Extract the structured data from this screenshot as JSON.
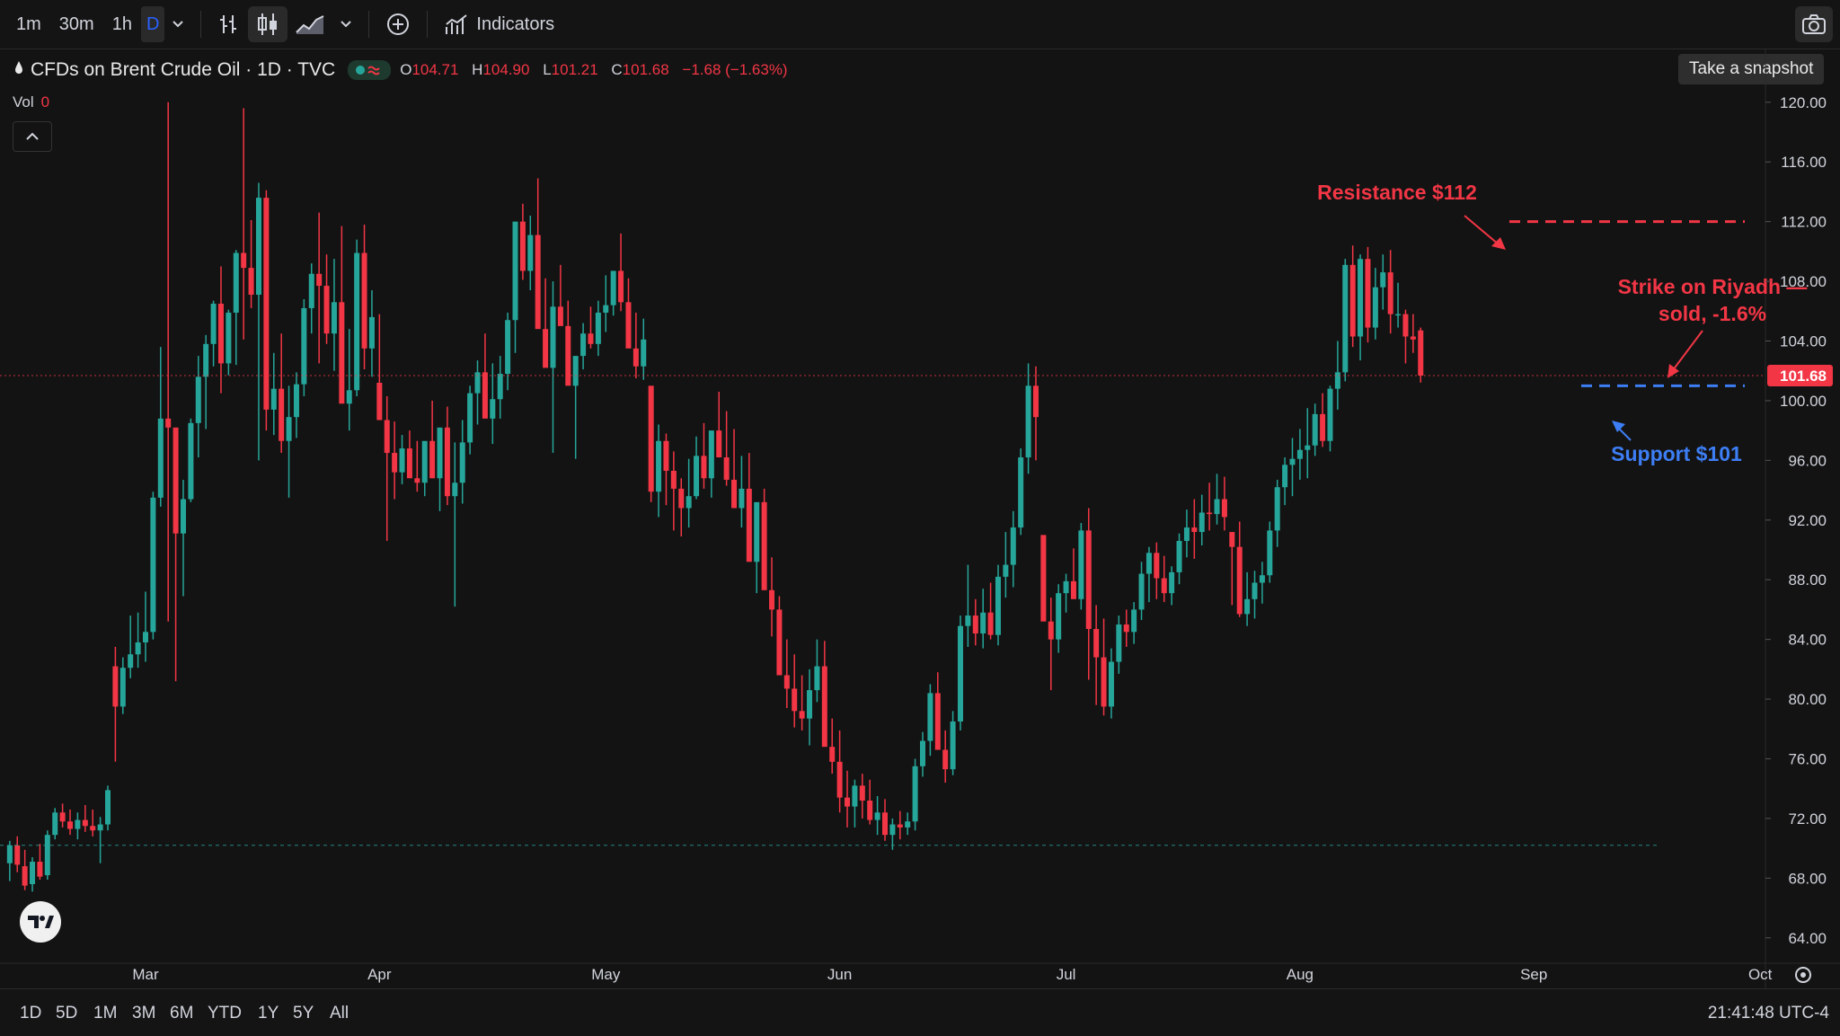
{
  "toolbar": {
    "timeframes": [
      "1m",
      "30m",
      "1h",
      "D"
    ],
    "indicators_label": "Indicators",
    "snapshot_tooltip": "Take a snapshot"
  },
  "legend": {
    "symbol": "CFDs on Brent Crude Oil · 1D · TVC",
    "o_label": "O",
    "o_value": "104.71",
    "h_label": "H",
    "h_value": "104.90",
    "l_label": "L",
    "l_value": "101.21",
    "c_label": "C",
    "c_value": "101.68",
    "change": "−1.68 (−1.63%)",
    "vol_label": "Vol",
    "vol_value": "0"
  },
  "colors": {
    "up": "#26a69a",
    "down": "#f23645",
    "support": "#3d7ef5",
    "background": "#131313"
  },
  "chart_data": {
    "type": "candlestick",
    "y_ticks": [
      "120.00",
      "116.00",
      "112.00",
      "108.00",
      "104.00",
      "100.00",
      "96.00",
      "92.00",
      "88.00",
      "84.00",
      "80.00",
      "76.00",
      "72.00",
      "68.00",
      "64.00"
    ],
    "ylim": [
      62.3,
      123.6
    ],
    "x_labels": [
      "Mar",
      "Apr",
      "May",
      "Jun",
      "Jul",
      "Aug",
      "Sep",
      "Oct"
    ],
    "x_label_days": [
      0,
      31,
      61,
      92,
      122,
      153,
      184,
      214
    ],
    "last_price": "101.68",
    "last_price_value": 101.68,
    "ohlc_days": [
      -18,
      -17,
      -16,
      -15,
      -14,
      -13,
      -12,
      -11,
      -10,
      -9,
      -8,
      -7,
      -6,
      -5,
      -4,
      -3,
      -2,
      -1,
      0,
      1,
      2,
      3,
      4,
      5,
      6,
      7,
      8,
      9,
      10,
      11,
      12,
      13,
      14,
      15,
      16,
      17,
      18,
      19,
      20,
      21,
      22,
      23,
      24,
      25,
      26,
      27,
      28,
      29,
      30,
      31,
      32,
      33,
      34,
      35,
      36,
      37,
      38,
      39,
      40,
      41,
      42,
      43,
      44,
      45,
      46,
      47,
      48,
      49,
      50,
      51,
      52,
      53,
      54,
      55,
      56,
      57,
      58,
      59,
      60,
      61,
      62,
      63,
      64,
      65,
      66,
      67,
      68,
      69,
      70,
      71,
      72,
      73,
      74,
      75,
      76,
      77,
      78,
      79,
      80,
      81,
      82,
      83,
      84,
      85,
      86,
      87,
      88,
      89,
      90,
      91,
      92,
      93,
      94,
      95,
      96,
      97,
      98,
      99,
      100,
      101,
      102,
      103,
      104,
      105,
      106,
      107,
      108,
      109,
      110,
      111,
      112,
      113,
      114,
      115,
      116,
      117,
      118,
      119,
      120,
      121,
      122,
      123,
      124,
      125,
      126,
      127,
      128,
      129,
      130,
      131,
      132,
      133,
      134,
      135,
      136,
      137,
      138,
      139,
      140,
      141,
      142,
      143,
      144,
      145,
      146,
      147,
      148,
      149,
      150,
      151,
      152,
      153,
      154,
      155,
      156,
      157,
      158,
      159,
      160,
      161,
      162,
      163,
      164,
      165,
      166,
      167,
      168,
      169,
      170,
      171,
      172,
      173,
      174,
      175,
      176,
      177,
      178,
      179,
      180,
      181,
      182,
      183,
      184,
      185,
      186,
      187,
      188,
      189,
      190,
      191,
      192,
      193,
      194,
      195,
      196,
      197,
      198,
      199,
      200
    ],
    "ohlc": [
      [
        69.0,
        70.5,
        67.8,
        70.2
      ],
      [
        70.2,
        70.8,
        68.4,
        68.9
      ],
      [
        68.8,
        69.9,
        67.2,
        67.5
      ],
      [
        67.6,
        69.4,
        67.1,
        69.1
      ],
      [
        69.1,
        70.3,
        67.9,
        68.1
      ],
      [
        68.2,
        71.2,
        67.9,
        70.9
      ],
      [
        70.9,
        72.7,
        70.6,
        72.4
      ],
      [
        72.4,
        73.0,
        71.4,
        71.8
      ],
      [
        71.8,
        72.6,
        70.9,
        71.3
      ],
      [
        71.3,
        72.4,
        70.6,
        71.9
      ],
      [
        71.9,
        72.9,
        71.1,
        71.5
      ],
      [
        71.5,
        72.6,
        70.8,
        71.2
      ],
      [
        71.2,
        72.1,
        69.0,
        71.6
      ],
      [
        71.6,
        74.2,
        71.2,
        73.9
      ],
      [
        82.2,
        83.5,
        75.8,
        79.5
      ],
      [
        79.5,
        82.8,
        79.0,
        82.1
      ],
      [
        82.1,
        85.6,
        81.4,
        83.0
      ],
      [
        83.0,
        85.8,
        82.1,
        83.8
      ],
      [
        83.8,
        87.2,
        82.5,
        84.5
      ],
      [
        84.5,
        93.9,
        84.0,
        93.5
      ],
      [
        93.5,
        103.6,
        92.9,
        98.8
      ],
      [
        98.8,
        120.0,
        85.2,
        98.2
      ],
      [
        98.2,
        97.5,
        81.2,
        91.1
      ],
      [
        91.1,
        94.7,
        86.9,
        93.4
      ],
      [
        93.4,
        98.8,
        93.2,
        98.5
      ],
      [
        98.5,
        103.0,
        96.2,
        101.6
      ],
      [
        101.6,
        104.4,
        98.1,
        103.8
      ],
      [
        103.8,
        106.7,
        102.3,
        106.5
      ],
      [
        106.5,
        109.0,
        100.5,
        102.5
      ],
      [
        102.5,
        106.1,
        101.7,
        105.9
      ],
      [
        105.9,
        110.1,
        102.4,
        109.9
      ],
      [
        109.9,
        119.6,
        104.1,
        108.9
      ],
      [
        108.9,
        112.1,
        106.2,
        107.1
      ],
      [
        107.1,
        114.6,
        96.0,
        113.6
      ],
      [
        113.6,
        114.1,
        98.0,
        99.4
      ],
      [
        99.4,
        103.2,
        97.7,
        100.8
      ],
      [
        100.8,
        104.5,
        96.5,
        97.3
      ],
      [
        97.3,
        101.0,
        93.5,
        98.9
      ],
      [
        98.9,
        101.9,
        97.5,
        101.1
      ],
      [
        101.1,
        106.8,
        100.3,
        106.2
      ],
      [
        106.2,
        109.2,
        104.5,
        108.5
      ],
      [
        108.5,
        112.6,
        102.5,
        107.7
      ],
      [
        107.7,
        109.8,
        103.8,
        104.5
      ],
      [
        104.5,
        109.5,
        102.0,
        106.6
      ],
      [
        106.6,
        111.7,
        102.5,
        99.8
      ],
      [
        99.8,
        104.8,
        98.0,
        100.7
      ],
      [
        100.7,
        110.8,
        100.3,
        109.9
      ],
      [
        109.9,
        111.8,
        102.1,
        103.5
      ],
      [
        103.5,
        107.4,
        101.6,
        105.6
      ],
      [
        101.2,
        105.8,
        99.4,
        98.7
      ],
      [
        98.7,
        100.3,
        90.6,
        96.5
      ],
      [
        96.5,
        98.6,
        93.4,
        95.2
      ],
      [
        95.2,
        97.7,
        94.4,
        96.8
      ],
      [
        96.8,
        98.0,
        95.0,
        94.8
      ],
      [
        94.8,
        97.3,
        93.9,
        94.5
      ],
      [
        94.5,
        97.2,
        93.6,
        97.3
      ],
      [
        97.3,
        100.0,
        95.1,
        94.8
      ],
      [
        94.8,
        97.6,
        92.6,
        98.2
      ],
      [
        98.2,
        99.6,
        93.0,
        93.6
      ],
      [
        93.6,
        97.2,
        86.2,
        94.5
      ],
      [
        94.5,
        98.7,
        93.1,
        97.2
      ],
      [
        97.2,
        101.0,
        96.4,
        100.5
      ],
      [
        100.5,
        102.7,
        98.4,
        101.9
      ],
      [
        101.9,
        104.5,
        99.4,
        98.8
      ],
      [
        98.8,
        102.5,
        97.1,
        100.1
      ],
      [
        100.1,
        103.0,
        98.8,
        101.8
      ],
      [
        101.8,
        105.9,
        100.7,
        105.4
      ],
      [
        105.4,
        110.1,
        103.2,
        112.0
      ],
      [
        112.0,
        113.2,
        108.1,
        108.7
      ],
      [
        108.7,
        112.4,
        107.4,
        111.1
      ],
      [
        111.1,
        114.9,
        108.3,
        104.8
      ],
      [
        104.8,
        108.2,
        104.0,
        102.2
      ],
      [
        102.2,
        108.0,
        96.5,
        106.3
      ],
      [
        106.3,
        109.1,
        105.4,
        105.0
      ],
      [
        105.0,
        106.7,
        103.9,
        101.0
      ],
      [
        101.0,
        102.9,
        96.1,
        103.0
      ],
      [
        103.0,
        105.2,
        102.1,
        104.5
      ],
      [
        104.5,
        106.3,
        103.5,
        103.8
      ],
      [
        103.8,
        106.7,
        103.0,
        105.9
      ],
      [
        105.9,
        108.4,
        104.6,
        106.4
      ],
      [
        106.4,
        107.8,
        105.7,
        108.7
      ],
      [
        108.7,
        111.2,
        106.0,
        106.6
      ],
      [
        106.6,
        108.2,
        104.5,
        103.5
      ],
      [
        103.5,
        105.9,
        101.5,
        102.3
      ],
      [
        102.3,
        105.5,
        101.4,
        104.1
      ],
      [
        101.0,
        98.8,
        93.2,
        93.9
      ],
      [
        93.9,
        98.4,
        92.2,
        97.3
      ],
      [
        97.3,
        97.8,
        93.0,
        95.3
      ],
      [
        95.3,
        96.6,
        91.3,
        94.1
      ],
      [
        94.1,
        94.8,
        90.9,
        92.8
      ],
      [
        92.8,
        96.1,
        91.5,
        93.6
      ],
      [
        93.6,
        97.6,
        93.4,
        96.3
      ],
      [
        96.3,
        98.5,
        94.1,
        94.8
      ],
      [
        94.8,
        97.9,
        93.5,
        98.0
      ],
      [
        98.0,
        100.6,
        96.2,
        96.2
      ],
      [
        96.2,
        99.3,
        94.3,
        94.7
      ],
      [
        94.7,
        98.1,
        93.7,
        92.8
      ],
      [
        92.8,
        96.3,
        91.5,
        94.1
      ],
      [
        94.1,
        96.5,
        92.2,
        89.2
      ],
      [
        89.2,
        92.6,
        87.1,
        93.2
      ],
      [
        93.2,
        94.1,
        89.9,
        87.3
      ],
      [
        87.3,
        89.5,
        84.2,
        86.0
      ],
      [
        86.0,
        86.9,
        82.4,
        81.6
      ],
      [
        81.6,
        84.0,
        79.4,
        80.7
      ],
      [
        80.7,
        83.0,
        78.1,
        79.2
      ],
      [
        79.2,
        81.6,
        77.9,
        78.7
      ],
      [
        78.7,
        82.0,
        76.9,
        80.6
      ],
      [
        80.6,
        84.0,
        79.8,
        82.2
      ],
      [
        82.2,
        83.9,
        80.4,
        76.8
      ],
      [
        76.8,
        78.7,
        75.0,
        75.8
      ],
      [
        75.8,
        77.9,
        72.4,
        73.4
      ],
      [
        73.4,
        75.2,
        71.4,
        72.8
      ],
      [
        72.8,
        74.6,
        71.4,
        74.2
      ],
      [
        74.2,
        75.0,
        72.0,
        73.2
      ],
      [
        73.2,
        74.6,
        71.6,
        71.9
      ],
      [
        71.9,
        73.5,
        70.9,
        72.4
      ],
      [
        72.4,
        73.3,
        70.5,
        70.9
      ],
      [
        70.9,
        72.0,
        69.9,
        71.6
      ],
      [
        71.6,
        72.5,
        70.6,
        71.4
      ],
      [
        71.4,
        72.4,
        70.9,
        71.8
      ],
      [
        71.8,
        76.0,
        71.2,
        75.5
      ],
      [
        75.5,
        77.8,
        74.8,
        77.2
      ],
      [
        77.2,
        81.0,
        76.2,
        80.4
      ],
      [
        80.4,
        81.8,
        77.3,
        76.6
      ],
      [
        76.6,
        77.9,
        74.4,
        75.3
      ],
      [
        75.3,
        79.2,
        74.9,
        78.5
      ],
      [
        78.5,
        85.6,
        77.9,
        84.9
      ],
      [
        84.9,
        89.0,
        83.5,
        85.6
      ],
      [
        85.6,
        86.7,
        83.6,
        84.4
      ],
      [
        84.4,
        87.4,
        83.4,
        85.8
      ],
      [
        85.8,
        87.8,
        84.0,
        84.3
      ],
      [
        84.3,
        89.0,
        83.6,
        88.2
      ],
      [
        88.2,
        91.2,
        86.8,
        89.0
      ],
      [
        89.0,
        92.6,
        87.5,
        91.5
      ],
      [
        91.5,
        96.8,
        91.0,
        96.2
      ],
      [
        96.2,
        102.5,
        95.1,
        101.0
      ],
      [
        101.0,
        102.3,
        96.0,
        98.9
      ],
      [
        91.0,
        88.3,
        85.4,
        85.2
      ],
      [
        85.2,
        86.8,
        80.6,
        84.0
      ],
      [
        84.0,
        87.7,
        83.1,
        87.1
      ],
      [
        87.1,
        88.4,
        85.8,
        87.9
      ],
      [
        87.9,
        90.1,
        86.8,
        86.7
      ],
      [
        86.7,
        91.8,
        86.0,
        91.3
      ],
      [
        91.3,
        92.8,
        81.3,
        84.7
      ],
      [
        84.7,
        86.3,
        79.6,
        82.8
      ],
      [
        82.8,
        85.4,
        78.9,
        79.5
      ],
      [
        79.5,
        83.4,
        78.7,
        82.5
      ],
      [
        82.5,
        85.6,
        81.7,
        85.0
      ],
      [
        85.0,
        86.0,
        83.5,
        84.5
      ],
      [
        84.5,
        86.5,
        83.7,
        86.0
      ],
      [
        86.0,
        89.2,
        85.3,
        88.4
      ],
      [
        88.4,
        90.2,
        86.5,
        89.8
      ],
      [
        89.8,
        90.5,
        86.7,
        88.1
      ],
      [
        88.1,
        89.6,
        86.5,
        87.1
      ],
      [
        87.1,
        88.9,
        86.3,
        88.5
      ],
      [
        88.5,
        91.1,
        87.7,
        90.6
      ],
      [
        90.6,
        92.7,
        89.5,
        91.5
      ],
      [
        91.5,
        93.4,
        89.4,
        91.2
      ],
      [
        91.2,
        93.7,
        90.3,
        92.5
      ],
      [
        92.5,
        94.5,
        91.3,
        92.4
      ],
      [
        92.4,
        95.1,
        91.7,
        93.4
      ],
      [
        93.4,
        94.9,
        91.3,
        92.2
      ],
      [
        91.2,
        90.6,
        86.3,
        90.2
      ],
      [
        90.2,
        91.9,
        85.5,
        85.7
      ],
      [
        85.7,
        88.5,
        84.9,
        86.7
      ],
      [
        86.7,
        88.6,
        85.4,
        87.8
      ],
      [
        87.8,
        89.2,
        86.4,
        88.3
      ],
      [
        88.3,
        91.9,
        87.8,
        91.3
      ],
      [
        91.3,
        94.7,
        90.2,
        94.2
      ],
      [
        94.2,
        96.2,
        93.0,
        95.7
      ],
      [
        95.7,
        97.5,
        93.6,
        96.1
      ],
      [
        96.1,
        98.1,
        94.7,
        96.7
      ],
      [
        96.7,
        99.5,
        94.8,
        97.0
      ],
      [
        97.0,
        99.8,
        96.3,
        99.1
      ],
      [
        99.1,
        100.5,
        96.9,
        97.3
      ],
      [
        97.3,
        101.0,
        96.6,
        100.8
      ],
      [
        100.8,
        104.0,
        99.4,
        101.9
      ],
      [
        101.9,
        109.5,
        101.3,
        109.1
      ],
      [
        109.1,
        110.4,
        103.6,
        104.3
      ],
      [
        104.3,
        109.8,
        102.7,
        109.5
      ],
      [
        109.5,
        110.3,
        103.9,
        104.9
      ],
      [
        104.9,
        108.9,
        104.1,
        107.6
      ],
      [
        107.6,
        109.8,
        106.1,
        108.6
      ],
      [
        108.6,
        110.1,
        104.5,
        105.8
      ],
      [
        105.8,
        107.9,
        104.9,
        105.8
      ],
      [
        105.8,
        106.1,
        102.5,
        104.3
      ],
      [
        104.3,
        105.8,
        103.2,
        104.1
      ],
      [
        104.71,
        104.9,
        101.21,
        101.68
      ]
    ],
    "levels": [
      {
        "label": "Resistance $112",
        "price": 112
      },
      {
        "label": "Support $101",
        "price": 101
      }
    ],
    "annotations": [
      {
        "line1": "Strike on Riyadh —",
        "line2": "sold, -1.6%"
      }
    ]
  },
  "bottombar": {
    "ranges": [
      "1D",
      "5D",
      "1M",
      "3M",
      "6M",
      "YTD",
      "1Y",
      "5Y",
      "All"
    ],
    "clock": "21:41:48 UTC-4"
  }
}
